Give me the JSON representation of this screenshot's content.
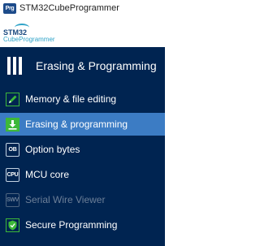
{
  "window": {
    "app_icon_text": "Prg",
    "title": "STM32CubeProgrammer"
  },
  "logo": {
    "line1": "STM32",
    "line2": "CubeProgrammer"
  },
  "menu": {
    "header_title": "Erasing & Programming",
    "items": [
      {
        "label": "Memory & file editing",
        "icon": "pencil-icon",
        "active": false,
        "enabled": true
      },
      {
        "label": "Erasing & programming",
        "icon": "download-icon",
        "active": true,
        "enabled": true
      },
      {
        "label": "Option bytes",
        "icon_text": "OB",
        "icon": "ob-icon",
        "active": false,
        "enabled": true
      },
      {
        "label": "MCU core",
        "icon_text": "CPU",
        "icon": "cpu-icon",
        "active": false,
        "enabled": true
      },
      {
        "label": "Serial Wire Viewer",
        "icon_text": "SWV",
        "icon": "swv-icon",
        "active": false,
        "enabled": false
      },
      {
        "label": "Secure Programming",
        "icon": "shield-icon",
        "active": false,
        "enabled": true
      }
    ]
  },
  "colors": {
    "menu_background": "#002451",
    "active_item": "#3c7cc4",
    "icon_green": "#3db839",
    "disabled_text": "#6c7f98"
  }
}
